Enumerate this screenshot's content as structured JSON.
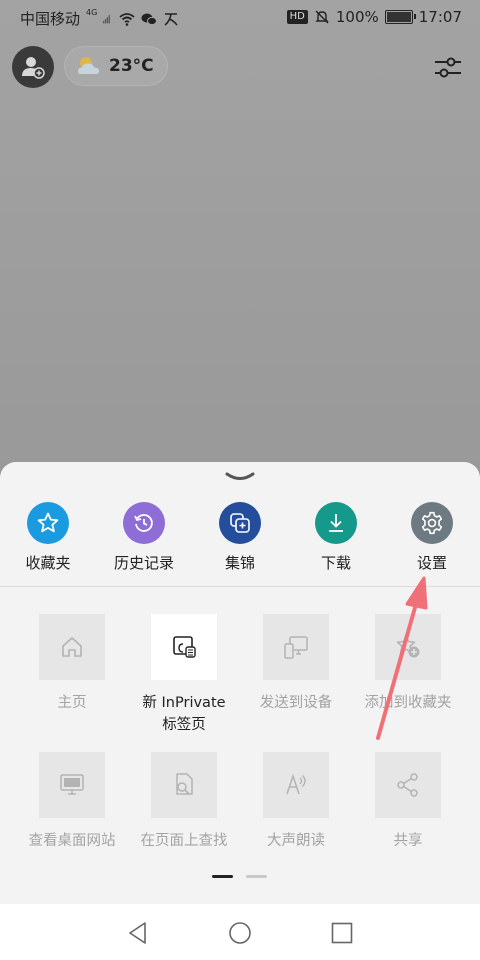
{
  "statusbar": {
    "carrier": "中国移动",
    "network": "4G",
    "badge": "HD",
    "battery": "100%",
    "time": "17:07"
  },
  "topbar": {
    "temperature": "23°C",
    "weather_icon": "partly-cloudy-icon"
  },
  "quick_actions": [
    {
      "label": "收藏夹",
      "icon": "star-icon",
      "color": "#1a9be0"
    },
    {
      "label": "历史记录",
      "icon": "history-icon",
      "color": "#8f6dd6"
    },
    {
      "label": "集锦",
      "icon": "collections-icon",
      "color": "#244e9c"
    },
    {
      "label": "下载",
      "icon": "download-icon",
      "color": "#14998a"
    },
    {
      "label": "设置",
      "icon": "gear-icon",
      "color": "#6e7a82"
    }
  ],
  "grid": [
    {
      "label": "主页",
      "icon": "home-icon"
    },
    {
      "label": "新 InPrivate\n标签页",
      "label_line1": "新 InPrivate",
      "label_line2": "标签页",
      "icon": "inprivate-icon"
    },
    {
      "label": "发送到设备",
      "icon": "send-to-device-icon"
    },
    {
      "label": "添加到收藏夹",
      "icon": "add-favorite-icon"
    },
    {
      "label": "查看桌面网站",
      "icon": "desktop-site-icon"
    },
    {
      "label": "在页面上查找",
      "icon": "find-in-page-icon"
    },
    {
      "label": "大声朗读",
      "icon": "read-aloud-icon"
    },
    {
      "label": "共享",
      "icon": "share-icon"
    }
  ],
  "annotation_color": "#f07078"
}
